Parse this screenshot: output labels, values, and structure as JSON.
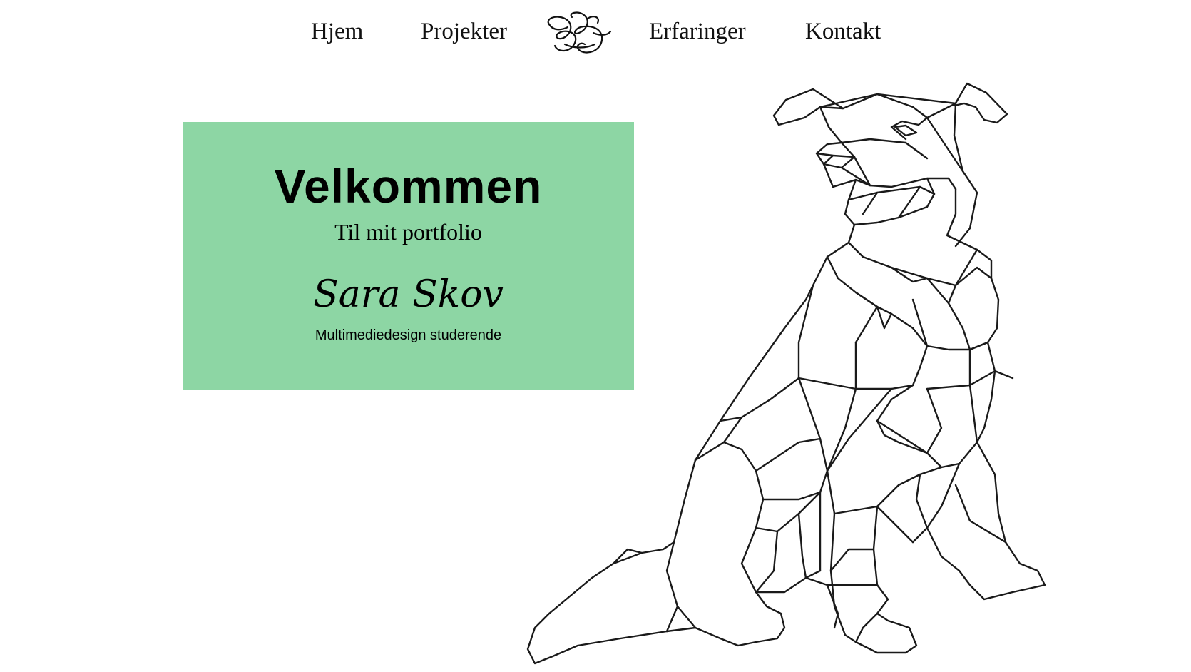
{
  "nav": {
    "items": [
      {
        "label": "Hjem"
      },
      {
        "label": "Projekter"
      },
      {
        "label": "Erfaringer"
      },
      {
        "label": "Kontakt"
      }
    ],
    "logo_icon": "ss-monogram-logo-icon"
  },
  "hero": {
    "title": "Velkommen",
    "subtitle": "Til mit portfolio",
    "name": "Sara Skov",
    "role": "Multimediedesign studerende",
    "background_color": "#8dd6a4"
  },
  "illustration": {
    "icon": "geometric-dog-illustration"
  }
}
